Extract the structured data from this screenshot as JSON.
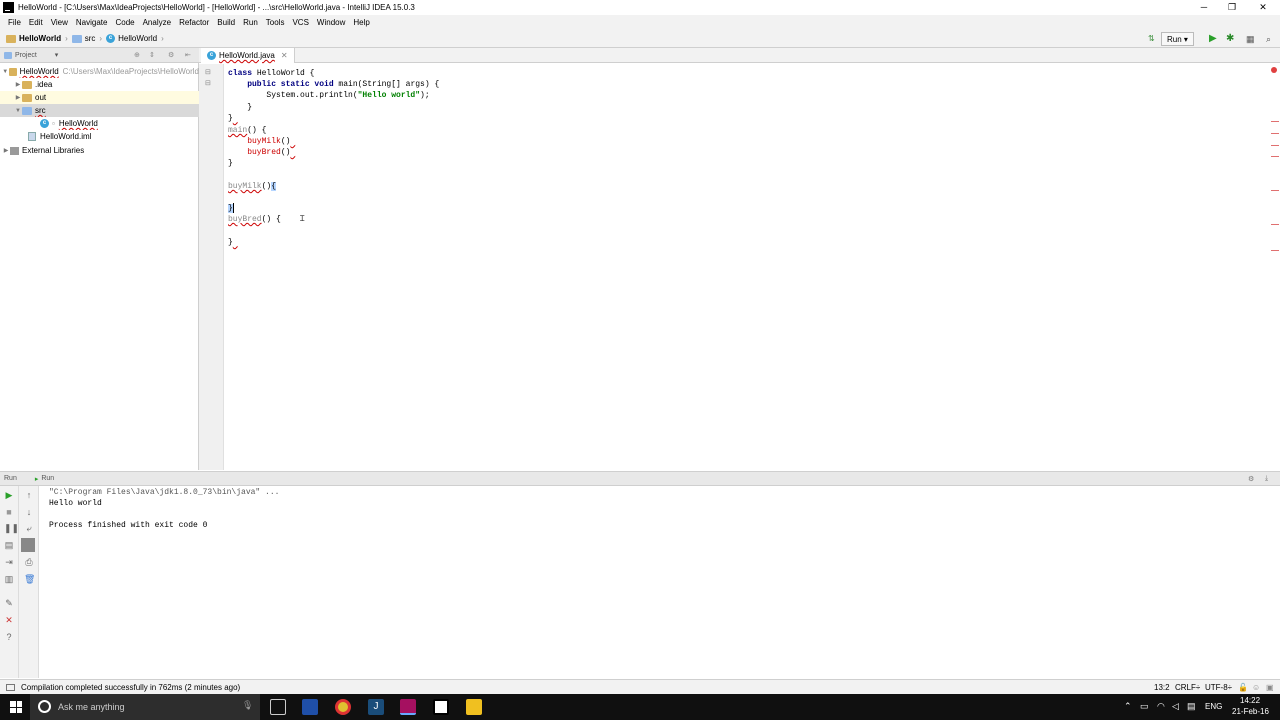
{
  "window": {
    "title": "HelloWorld - [C:\\Users\\Max\\IdeaProjects\\HelloWorld] - [HelloWorld] - ...\\src\\HelloWorld.java - IntelliJ IDEA 15.0.3",
    "controls": {
      "minimize": "─",
      "maximize": "❐",
      "close": "✕"
    }
  },
  "menu": [
    "File",
    "Edit",
    "View",
    "Navigate",
    "Code",
    "Analyze",
    "Refactor",
    "Build",
    "Run",
    "Tools",
    "VCS",
    "Window",
    "Help"
  ],
  "navbar": {
    "crumbs": [
      "HelloWorld",
      "src",
      "HelloWorld"
    ],
    "run_config": "Run"
  },
  "project_panel": {
    "header": "Project",
    "tree": [
      {
        "label": "HelloWorld",
        "path": "C:\\Users\\Max\\IdeaProjects\\HelloWorld"
      },
      {
        "label": ".idea"
      },
      {
        "label": "out"
      },
      {
        "label": "src"
      },
      {
        "label": "HelloWorld"
      },
      {
        "label": "HelloWorld.iml"
      },
      {
        "label": "External Libraries"
      }
    ]
  },
  "editor": {
    "tab": "HelloWorld.java",
    "lines": [
      {
        "t": "class HelloWorld {"
      },
      {
        "t": "    public static void main(String[] args) {"
      },
      {
        "t": "        System.out.println(\"Hello world\");"
      },
      {
        "t": "    }"
      },
      {
        "t": "}"
      },
      {
        "t": "main() {"
      },
      {
        "t": "    buyMilk()"
      },
      {
        "t": "    buyBred()"
      },
      {
        "t": "}"
      },
      {
        "t": "buyMilk() {"
      },
      {
        "t": "}"
      },
      {
        "t": "buyBred() {"
      },
      {
        "t": "}"
      }
    ]
  },
  "run_panel": {
    "header": "Run",
    "tab": "Run",
    "console": [
      "\"C:\\Program Files\\Java\\jdk1.8.0_73\\bin\\java\" ...",
      "Hello world",
      "",
      "Process finished with exit code 0"
    ]
  },
  "status": {
    "message": "Compilation completed successfully in 762ms (2 minutes ago)",
    "position": "13:2",
    "line_sep": "CRLF÷",
    "encoding": "UTF-8÷"
  },
  "taskbar": {
    "search_placeholder": "Ask me anything",
    "lang": "ENG",
    "time": "14:22",
    "date": "21-Feb-16"
  },
  "colors": {
    "keyword": "#000080",
    "string": "#008000",
    "error": "#cc0000",
    "selection": "#d9d9d9",
    "taskbar": "#101010"
  }
}
